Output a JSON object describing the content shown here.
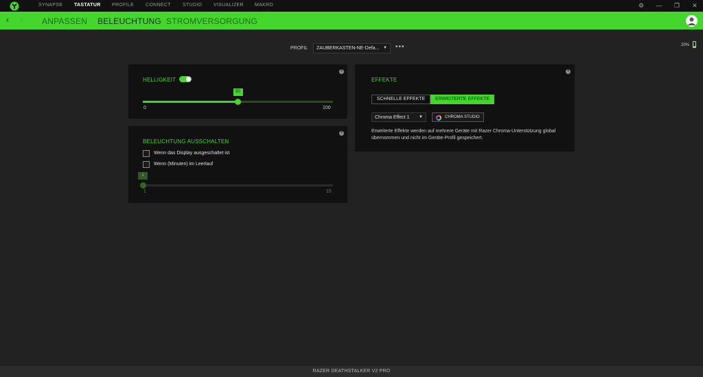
{
  "nav": {
    "items": [
      {
        "label": "SYNAPSE"
      },
      {
        "label": "TASTATUR"
      },
      {
        "label": "PROFILE"
      },
      {
        "label": "CONNECT"
      },
      {
        "label": "STUDIO"
      },
      {
        "label": "VISUALIZER"
      },
      {
        "label": "MAKRO"
      }
    ],
    "active": "TASTATUR"
  },
  "subnav": {
    "tabs": [
      {
        "label": "ANPASSEN"
      },
      {
        "label": "BELEUCHTUNG"
      },
      {
        "label": "STROMVERSORGUNG"
      }
    ],
    "active": "BELEUCHTUNG"
  },
  "profile": {
    "label": "PROFIL",
    "value": "ZAUBERKASTEN-NE-Defa...",
    "more": "•••"
  },
  "battery": {
    "text": "20%",
    "level": 0.2
  },
  "brightness": {
    "title": "HELLIGKEIT",
    "enabled": true,
    "value": 50,
    "value_label": "50",
    "min_label": "0",
    "max_label": "100",
    "min": 0,
    "max": 100
  },
  "lights_off": {
    "title": "BELEUCHTUNG AUSSCHALTEN",
    "option_display": "Wenn das Display ausgeschaltet ist",
    "option_idle": "Wenn (Minuten) im Leerlauf",
    "option_display_checked": false,
    "option_idle_checked": false,
    "idle_value": 1,
    "idle_value_label": "1",
    "min_label": "1",
    "max_label": "15",
    "min": 1,
    "max": 15
  },
  "effects": {
    "title": "EFFEKTE",
    "quick_label": "SCHNELLE EFFEKTE",
    "advanced_label": "ERWEITERTE EFFEKTE",
    "selected_mode": "advanced",
    "effect_value": "Chroma Effect 1",
    "studio_label": "CHROMA STUDIO",
    "description": "Erweiterte Effekte werden auf mehrere Geräte mit Razer Chroma-Unterstützung global übernommen und nicht im Geräte-Profil gespeichert."
  },
  "help_glyph": "?",
  "window_controls": {
    "settings": "⚙",
    "minimize": "—",
    "restore": "❐",
    "close": "✕"
  },
  "footer": {
    "device": "RAZER DEATHSTALKER V2 PRO"
  },
  "colors": {
    "accent": "#44d62c",
    "background": "#222222",
    "card": "#111111"
  }
}
